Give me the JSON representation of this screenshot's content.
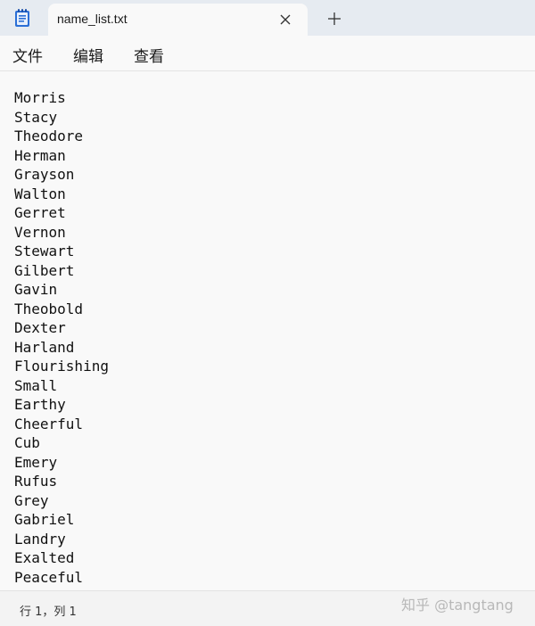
{
  "tab": {
    "title": "name_list.txt",
    "close_icon": "close-icon",
    "new_tab_icon": "plus-icon"
  },
  "app": {
    "icon": "notepad-icon",
    "accent_color": "#2b6fd6"
  },
  "menu": {
    "items": [
      "文件",
      "编辑",
      "查看"
    ]
  },
  "editor": {
    "lines": [
      "Morris",
      "Stacy",
      "Theodore",
      "Herman",
      "Grayson",
      "Walton",
      "Gerret",
      "Vernon",
      "Stewart",
      "Gilbert",
      "Gavin",
      "Theobold",
      "Dexter",
      "Harland",
      "Flourishing",
      "Small",
      "Earthy",
      "Cheerful",
      "Cub",
      "Emery",
      "Rufus",
      "Grey",
      "Gabriel",
      "Landry",
      "Exalted",
      "Peaceful"
    ]
  },
  "status": {
    "cursor_position": "行 1，列 1"
  },
  "watermark": {
    "text": "知乎 @tangtang"
  }
}
